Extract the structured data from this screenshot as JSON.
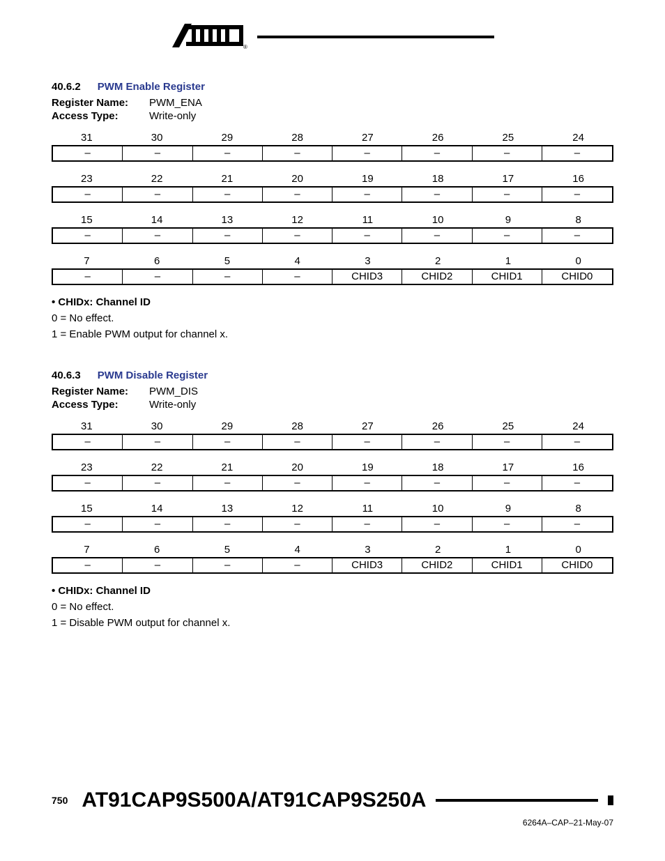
{
  "logo_text": "ATMEL",
  "sections": [
    {
      "num": "40.6.2",
      "title": "PWM Enable Register",
      "register_name_label": "Register Name:",
      "register_name": "PWM_ENA",
      "access_type_label": "Access Type:",
      "access_type": "Write-only",
      "rows": [
        {
          "bits": [
            "31",
            "30",
            "29",
            "28",
            "27",
            "26",
            "25",
            "24"
          ],
          "cells": [
            "–",
            "–",
            "–",
            "–",
            "–",
            "–",
            "–",
            "–"
          ]
        },
        {
          "bits": [
            "23",
            "22",
            "21",
            "20",
            "19",
            "18",
            "17",
            "16"
          ],
          "cells": [
            "–",
            "–",
            "–",
            "–",
            "–",
            "–",
            "–",
            "–"
          ]
        },
        {
          "bits": [
            "15",
            "14",
            "13",
            "12",
            "11",
            "10",
            "9",
            "8"
          ],
          "cells": [
            "–",
            "–",
            "–",
            "–",
            "–",
            "–",
            "–",
            "–"
          ]
        },
        {
          "bits": [
            "7",
            "6",
            "5",
            "4",
            "3",
            "2",
            "1",
            "0"
          ],
          "cells": [
            "–",
            "–",
            "–",
            "–",
            "CHID3",
            "CHID2",
            "CHID1",
            "CHID0"
          ]
        }
      ],
      "field_title": "CHIDx: Channel ID",
      "line0": "0 = No effect.",
      "line1": "1 = Enable PWM output for channel x."
    },
    {
      "num": "40.6.3",
      "title": "PWM Disable Register",
      "register_name_label": "Register Name:",
      "register_name": "PWM_DIS",
      "access_type_label": "Access Type:",
      "access_type": "Write-only",
      "rows": [
        {
          "bits": [
            "31",
            "30",
            "29",
            "28",
            "27",
            "26",
            "25",
            "24"
          ],
          "cells": [
            "–",
            "–",
            "–",
            "–",
            "–",
            "–",
            "–",
            "–"
          ]
        },
        {
          "bits": [
            "23",
            "22",
            "21",
            "20",
            "19",
            "18",
            "17",
            "16"
          ],
          "cells": [
            "–",
            "–",
            "–",
            "–",
            "–",
            "–",
            "–",
            "–"
          ]
        },
        {
          "bits": [
            "15",
            "14",
            "13",
            "12",
            "11",
            "10",
            "9",
            "8"
          ],
          "cells": [
            "–",
            "–",
            "–",
            "–",
            "–",
            "–",
            "–",
            "–"
          ]
        },
        {
          "bits": [
            "7",
            "6",
            "5",
            "4",
            "3",
            "2",
            "1",
            "0"
          ],
          "cells": [
            "–",
            "–",
            "–",
            "–",
            "CHID3",
            "CHID2",
            "CHID1",
            "CHID0"
          ]
        }
      ],
      "field_title": "CHIDx: Channel ID",
      "line0": "0 = No effect.",
      "line1": "1 = Disable PWM output for channel x."
    }
  ],
  "footer": {
    "page_num": "750",
    "title": "AT91CAP9S500A/AT91CAP9S250A",
    "docid": "6264A–CAP–21-May-07"
  }
}
